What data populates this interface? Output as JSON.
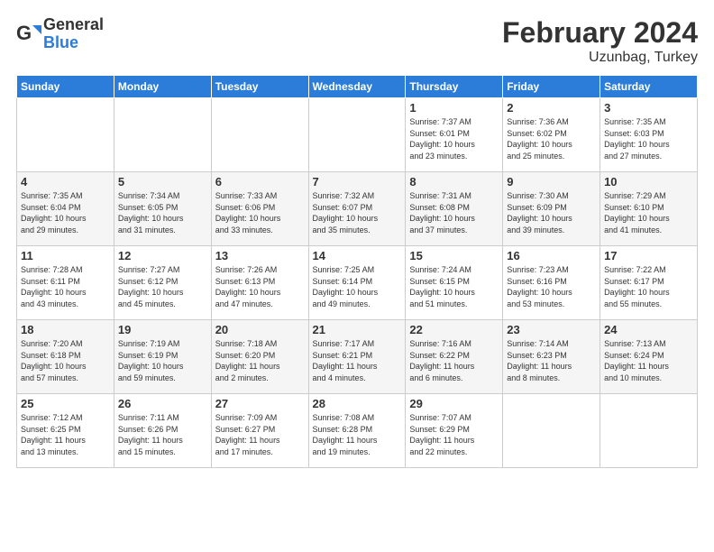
{
  "logo": {
    "line1": "General",
    "line2": "Blue"
  },
  "title": "February 2024",
  "subtitle": "Uzunbag, Turkey",
  "days_of_week": [
    "Sunday",
    "Monday",
    "Tuesday",
    "Wednesday",
    "Thursday",
    "Friday",
    "Saturday"
  ],
  "weeks": [
    [
      {
        "day": "",
        "info": ""
      },
      {
        "day": "",
        "info": ""
      },
      {
        "day": "",
        "info": ""
      },
      {
        "day": "",
        "info": ""
      },
      {
        "day": "1",
        "info": "Sunrise: 7:37 AM\nSunset: 6:01 PM\nDaylight: 10 hours\nand 23 minutes."
      },
      {
        "day": "2",
        "info": "Sunrise: 7:36 AM\nSunset: 6:02 PM\nDaylight: 10 hours\nand 25 minutes."
      },
      {
        "day": "3",
        "info": "Sunrise: 7:35 AM\nSunset: 6:03 PM\nDaylight: 10 hours\nand 27 minutes."
      }
    ],
    [
      {
        "day": "4",
        "info": "Sunrise: 7:35 AM\nSunset: 6:04 PM\nDaylight: 10 hours\nand 29 minutes."
      },
      {
        "day": "5",
        "info": "Sunrise: 7:34 AM\nSunset: 6:05 PM\nDaylight: 10 hours\nand 31 minutes."
      },
      {
        "day": "6",
        "info": "Sunrise: 7:33 AM\nSunset: 6:06 PM\nDaylight: 10 hours\nand 33 minutes."
      },
      {
        "day": "7",
        "info": "Sunrise: 7:32 AM\nSunset: 6:07 PM\nDaylight: 10 hours\nand 35 minutes."
      },
      {
        "day": "8",
        "info": "Sunrise: 7:31 AM\nSunset: 6:08 PM\nDaylight: 10 hours\nand 37 minutes."
      },
      {
        "day": "9",
        "info": "Sunrise: 7:30 AM\nSunset: 6:09 PM\nDaylight: 10 hours\nand 39 minutes."
      },
      {
        "day": "10",
        "info": "Sunrise: 7:29 AM\nSunset: 6:10 PM\nDaylight: 10 hours\nand 41 minutes."
      }
    ],
    [
      {
        "day": "11",
        "info": "Sunrise: 7:28 AM\nSunset: 6:11 PM\nDaylight: 10 hours\nand 43 minutes."
      },
      {
        "day": "12",
        "info": "Sunrise: 7:27 AM\nSunset: 6:12 PM\nDaylight: 10 hours\nand 45 minutes."
      },
      {
        "day": "13",
        "info": "Sunrise: 7:26 AM\nSunset: 6:13 PM\nDaylight: 10 hours\nand 47 minutes."
      },
      {
        "day": "14",
        "info": "Sunrise: 7:25 AM\nSunset: 6:14 PM\nDaylight: 10 hours\nand 49 minutes."
      },
      {
        "day": "15",
        "info": "Sunrise: 7:24 AM\nSunset: 6:15 PM\nDaylight: 10 hours\nand 51 minutes."
      },
      {
        "day": "16",
        "info": "Sunrise: 7:23 AM\nSunset: 6:16 PM\nDaylight: 10 hours\nand 53 minutes."
      },
      {
        "day": "17",
        "info": "Sunrise: 7:22 AM\nSunset: 6:17 PM\nDaylight: 10 hours\nand 55 minutes."
      }
    ],
    [
      {
        "day": "18",
        "info": "Sunrise: 7:20 AM\nSunset: 6:18 PM\nDaylight: 10 hours\nand 57 minutes."
      },
      {
        "day": "19",
        "info": "Sunrise: 7:19 AM\nSunset: 6:19 PM\nDaylight: 10 hours\nand 59 minutes."
      },
      {
        "day": "20",
        "info": "Sunrise: 7:18 AM\nSunset: 6:20 PM\nDaylight: 11 hours\nand 2 minutes."
      },
      {
        "day": "21",
        "info": "Sunrise: 7:17 AM\nSunset: 6:21 PM\nDaylight: 11 hours\nand 4 minutes."
      },
      {
        "day": "22",
        "info": "Sunrise: 7:16 AM\nSunset: 6:22 PM\nDaylight: 11 hours\nand 6 minutes."
      },
      {
        "day": "23",
        "info": "Sunrise: 7:14 AM\nSunset: 6:23 PM\nDaylight: 11 hours\nand 8 minutes."
      },
      {
        "day": "24",
        "info": "Sunrise: 7:13 AM\nSunset: 6:24 PM\nDaylight: 11 hours\nand 10 minutes."
      }
    ],
    [
      {
        "day": "25",
        "info": "Sunrise: 7:12 AM\nSunset: 6:25 PM\nDaylight: 11 hours\nand 13 minutes."
      },
      {
        "day": "26",
        "info": "Sunrise: 7:11 AM\nSunset: 6:26 PM\nDaylight: 11 hours\nand 15 minutes."
      },
      {
        "day": "27",
        "info": "Sunrise: 7:09 AM\nSunset: 6:27 PM\nDaylight: 11 hours\nand 17 minutes."
      },
      {
        "day": "28",
        "info": "Sunrise: 7:08 AM\nSunset: 6:28 PM\nDaylight: 11 hours\nand 19 minutes."
      },
      {
        "day": "29",
        "info": "Sunrise: 7:07 AM\nSunset: 6:29 PM\nDaylight: 11 hours\nand 22 minutes."
      },
      {
        "day": "",
        "info": ""
      },
      {
        "day": "",
        "info": ""
      }
    ]
  ]
}
